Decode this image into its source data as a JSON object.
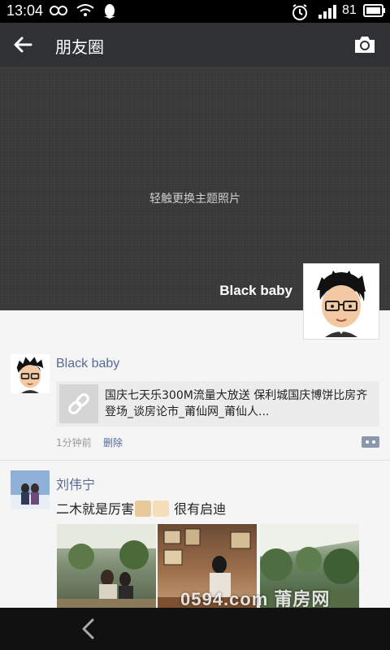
{
  "status_bar": {
    "time": "13:04",
    "battery_level": "81",
    "icons": [
      "infinity-icon",
      "wifi-hotspot-icon",
      "qq-penguin-icon",
      "alarm-icon",
      "signal-icon",
      "battery-icon"
    ]
  },
  "app_bar": {
    "title": "朋友圈",
    "back_icon": "arrow-left-icon",
    "camera_icon": "camera-icon"
  },
  "cover": {
    "hint": "轻触更换主题照片",
    "nickname": "Black baby"
  },
  "posts": [
    {
      "name": "Black baby",
      "link_text": "国庆七天乐300M流量大放送 保利城国庆博饼比房齐登场_谈房论市_莆仙网_莆仙人...",
      "time": "1分钟前",
      "delete_label": "删除"
    },
    {
      "name": "刘伟宁",
      "text_before": "二木就是厉害",
      "text_after": "很有启迪"
    }
  ],
  "watermark": "0594.com 莆房网",
  "colors": {
    "name_blue": "#576b95",
    "app_bar": "#2f3133",
    "feed_bg": "#f5f5f5"
  }
}
